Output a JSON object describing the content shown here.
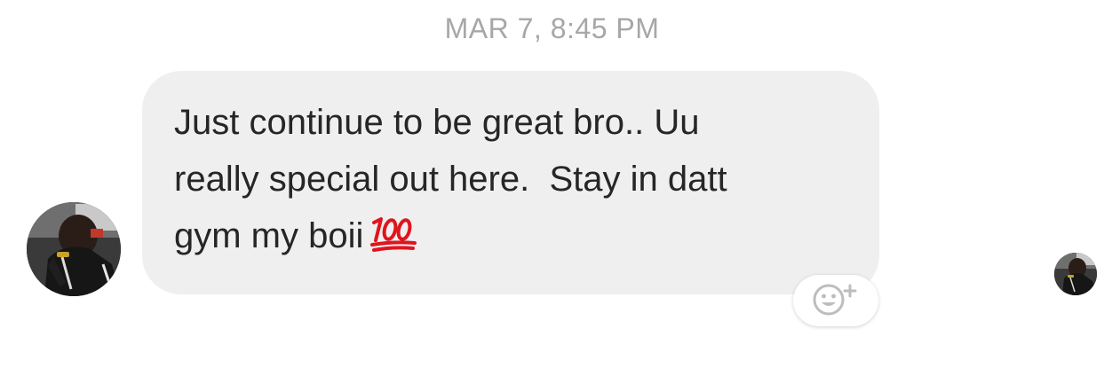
{
  "thread": {
    "timestamp": "MAR 7, 8:45 PM"
  },
  "message": {
    "lines": [
      "Just continue to be great bro.. Uu",
      "really special out here.  Stay in datt",
      "gym my boii"
    ],
    "emoji": "💯",
    "bubble_color": "#efefef",
    "text_color": "#262626"
  },
  "icons": {
    "reaction": "smiley-plus-icon",
    "hundred": "hundred-points-emoji"
  },
  "colors": {
    "timestamp": "#a7a7a7",
    "background": "#ffffff",
    "hundred_emoji": "#e0141e"
  }
}
